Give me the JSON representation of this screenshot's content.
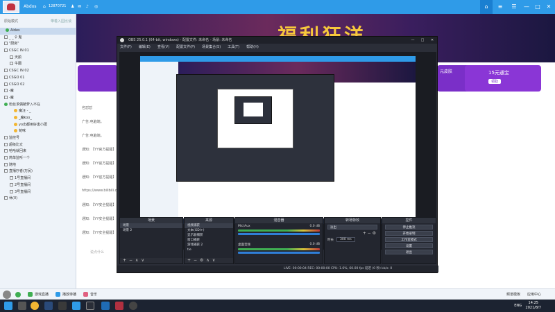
{
  "topbar": {
    "app_name": "Abdos",
    "id_number": "12870721",
    "colors": {
      "bar": "#2f9be8"
    }
  },
  "left_panel": {
    "header_left": "原始模式",
    "header_right": "带着入园比谈",
    "channel_title": "Aides",
    "rows": [
      {
        "label": "_ _ ♀ 鬼",
        "icon": "plus"
      },
      {
        "label": "\"厨房\"",
        "icon": "plus"
      },
      {
        "label": "CSGC IN 01",
        "icon": "plus"
      },
      {
        "label": "天颜",
        "icon": "plus"
      },
      {
        "label": "牛圈",
        "icon": "plus"
      },
      {
        "label": "CSGC IN 02",
        "icon": "plus"
      },
      {
        "label": "CSGO 01",
        "icon": "plus"
      },
      {
        "label": "CSGO 02",
        "icon": "plus"
      },
      {
        "label": "-魔",
        "icon": "plus"
      },
      {
        "label": "-魔",
        "icon": "plus"
      },
      {
        "label": "粉丝求偶破萝入不在",
        "icon": "green"
      },
      {
        "label": "魔汪 - _",
        "icon": "user"
      },
      {
        "label": "_魔koo_",
        "icon": "user"
      },
      {
        "label": "yo出都用好害小团",
        "icon": "user"
      },
      {
        "label": "苟咪",
        "icon": "user"
      },
      {
        "label": "监控号",
        "icon": "plus"
      },
      {
        "label": "超级比丈",
        "icon": "plus"
      },
      {
        "label": "哈哈就回来",
        "icon": "plus"
      },
      {
        "label": "简单监听一个",
        "icon": "plus"
      },
      {
        "label": "随地",
        "icon": "plus"
      },
      {
        "label": "直播厅者(万民)",
        "icon": "plus"
      },
      {
        "label": "1号直播间",
        "icon": "plus"
      },
      {
        "label": "2号直播间",
        "icon": "plus"
      },
      {
        "label": "3号直播间",
        "icon": "plus"
      },
      {
        "label": "休(0)",
        "icon": "plus"
      }
    ]
  },
  "banner": {
    "title": "福利狂洋",
    "right_promo": "15元通宝",
    "right_promo_btn": "领取",
    "left_promo": "元皮肤",
    "left_promo_btn": "领取"
  },
  "chat": {
    "lines": [
      "名怼怼",
      "广告:电脑端。",
      "广告:电脑端。",
      "通知: 【YY官方提醒】",
      "通知: 【YY官方提醒】",
      "通知: 【YY官方提醒】",
      "https://www.bilibili.com",
      "通知: 【YY安全提醒】",
      "通知: 【YY安全提醒】",
      "通知: 【YY安全提醒】"
    ],
    "input_placeholder": "说点什么"
  },
  "obs": {
    "title": "OBS 25.0.1 (64-bit, windows) - 配置文件: 未命名 - 场景: 未命名",
    "menu": [
      "文件(F)",
      "编辑(E)",
      "查看(V)",
      "配置文件(P)",
      "场景集合(S)",
      "工具(T)",
      "帮助(H)"
    ],
    "docks": {
      "scenes": {
        "header": "场景",
        "items": [
          "场景",
          "场景 2"
        ]
      },
      "sources": {
        "header": "来源",
        "items": [
          "视频捕获",
          "文本(GDI+)",
          "显示器捕获",
          "窗口捕获",
          "游戏捕获 2",
          "tie"
        ]
      },
      "mixer": {
        "header": "混音器",
        "channels": [
          {
            "name": "Mic/Aux",
            "db": "0.0 dB"
          },
          {
            "name": "桌面音频",
            "db": "0.0 dB"
          }
        ]
      },
      "transitions": {
        "header": "转场特效",
        "type": "淡出",
        "duration_label": "时长",
        "duration": "300 ms"
      },
      "controls": {
        "header": "控件",
        "buttons": [
          "停止推流",
          "开始录制",
          "工作室模式",
          "设置",
          "退出"
        ]
      }
    },
    "status": "LIVE: 00:00:04    REC: 00:00:00    CPU: 1.6%, 60.00 fps    延迟 (0 秒)    kb/s: 0"
  },
  "yybar": {
    "items": [
      "游戏直播",
      "播放待播",
      "音乐"
    ],
    "right_items": [
      "频道模板",
      "应用中心"
    ]
  },
  "taskbar": {
    "time": "14:25",
    "date": "2021/8/7",
    "lang": "ENG"
  }
}
